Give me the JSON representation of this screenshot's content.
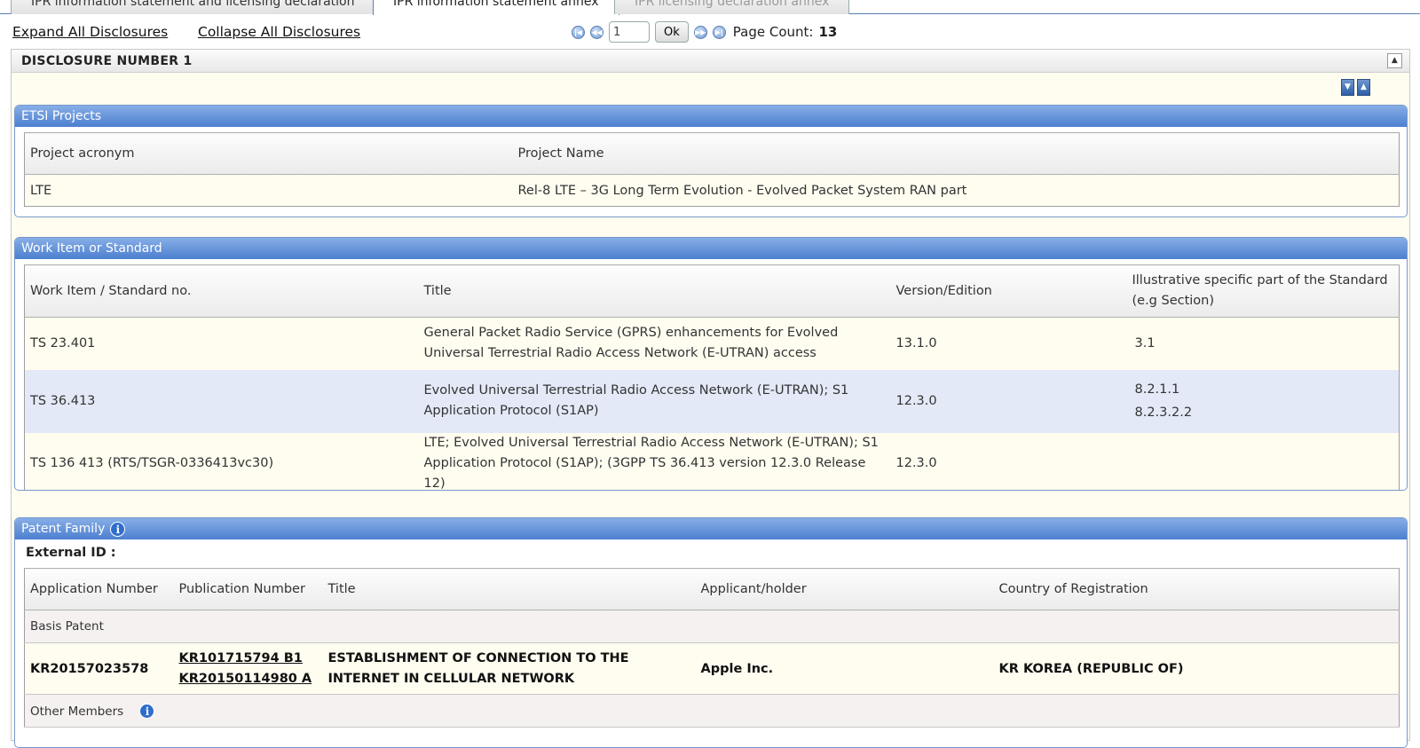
{
  "tabs": [
    {
      "label": "IPR information statement and licensing declaration",
      "state": "normal"
    },
    {
      "label": "IPR information statement annex",
      "state": "active"
    },
    {
      "label": "IPR licensing declaration annex",
      "state": "disabled"
    }
  ],
  "toolbar": {
    "expand_all": "Expand All Disclosures",
    "collapse_all": "Collapse All Disclosures",
    "page_value": "1",
    "ok_label": "Ok",
    "page_count_label": "Page Count:",
    "page_count": "13"
  },
  "disclosure": {
    "title": "DISCLOSURE NUMBER 1"
  },
  "etsi_projects": {
    "title": "ETSI Projects",
    "columns": [
      "Project acronym",
      "Project Name"
    ],
    "rows": [
      [
        "LTE",
        "Rel-8 LTE – 3G Long Term Evolution - Evolved Packet System RAN part"
      ]
    ]
  },
  "work_items": {
    "title": "Work Item or Standard",
    "columns": [
      "Work Item / Standard no.",
      "Title",
      "Version/Edition",
      "Illustrative specific part of the Standard (e.g Section)"
    ],
    "rows": [
      {
        "no": "TS 23.401",
        "title": "General Packet Radio Service (GPRS) enhancements for Evolved Universal Terrestrial Radio Access Network (E-UTRAN) access",
        "version": "13.1.0",
        "section_1": "3.1",
        "section_2": ""
      },
      {
        "no": "TS 36.413",
        "title": "Evolved Universal Terrestrial Radio Access Network (E-UTRAN); S1 Application Protocol (S1AP)",
        "version": "12.3.0",
        "section_1": "8.2.1.1",
        "section_2": "8.2.3.2.2"
      },
      {
        "no": "TS 136 413 (RTS/TSGR-0336413vc30)",
        "title": "LTE; Evolved Universal Terrestrial Radio Access Network (E-UTRAN); S1 Application Protocol (S1AP); (3GPP TS 36.413 version 12.3.0 Release 12)",
        "version": "12.3.0",
        "section_1": "",
        "section_2": ""
      }
    ]
  },
  "patent_family": {
    "title": "Patent Family",
    "external_id_label": "External ID :",
    "columns": [
      "Application Number",
      "Publication Number",
      "Title",
      "Applicant/holder",
      "Country of Registration"
    ],
    "basis_label": "Basis Patent",
    "basis": {
      "application": "KR20157023578",
      "publication_1": "KR101715794 B1",
      "publication_2": "KR20150114980 A",
      "title": "ESTABLISHMENT OF CONNECTION TO THE INTERNET IN CELLULAR NETWORK",
      "applicant": "Apple Inc.",
      "country": "KR KOREA (REPUBLIC OF)"
    },
    "other_members_label": "Other Members"
  },
  "colors": {
    "section_header": "#4c7fd0",
    "row_yellow": "#fffdf0",
    "row_blue": "#e3e9f7"
  },
  "icons": [
    "first-page-icon",
    "prev-page-icon",
    "next-page-icon",
    "last-page-icon",
    "collapse-up-icon",
    "expand-all-icon",
    "collapse-all-icon",
    "info-icon"
  ]
}
